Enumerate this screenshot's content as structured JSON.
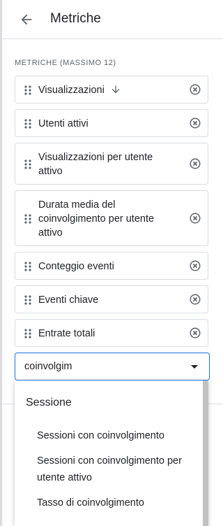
{
  "header": {
    "title": "Metriche"
  },
  "section": {
    "label": "METRICHE (MASSIMO 12)"
  },
  "metrics": [
    {
      "label": "Visualizzazioni",
      "sorted": true
    },
    {
      "label": "Utenti attivi"
    },
    {
      "label": "Visualizzazioni per utente attivo"
    },
    {
      "label": "Durata media del coinvolgimento per utente attivo"
    },
    {
      "label": "Conteggio eventi"
    },
    {
      "label": "Eventi chiave"
    },
    {
      "label": "Entrate totali"
    }
  ],
  "search": {
    "value": "coinvolgim"
  },
  "dropdown": {
    "group": "Sessione",
    "options": [
      "Sessioni con coinvolgimento",
      "Sessioni con coinvolgimento per utente attivo",
      "Tasso di coinvolgimento"
    ]
  },
  "colors": {
    "accent": "#1a73e8",
    "border": "#dadce0",
    "icon": "#5f6368",
    "text": "#202124"
  }
}
